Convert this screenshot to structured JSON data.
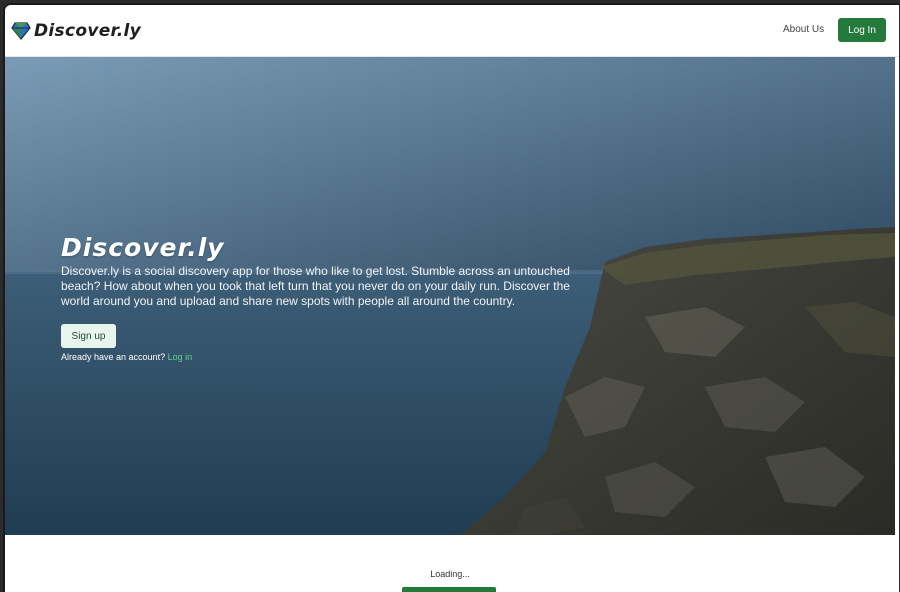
{
  "navbar": {
    "brand": "Discover.ly",
    "about_label": "About Us",
    "login_label": "Log In"
  },
  "hero": {
    "title": "Discover.ly",
    "description": "Discover.ly is a social discovery app for those who like to get lost. Stumble across an untouched beach? How about when you took that left turn that you never do on your daily run. Discover the world around you and upload and share new spots with people all around the country.",
    "signup_label": "Sign up",
    "already_text": "Already have an account?",
    "login_link": "Log in"
  },
  "status": {
    "loading": "Loading..."
  },
  "colors": {
    "brand_green": "#237a3a",
    "link_green": "#5fd08a"
  }
}
